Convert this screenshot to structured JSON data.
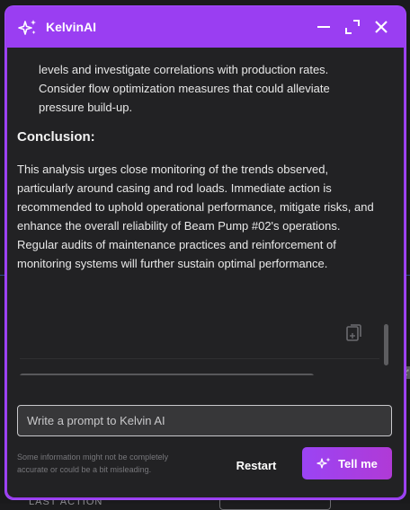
{
  "window": {
    "title": "KelvinAI"
  },
  "chat": {
    "continuation_text": "levels and investigate correlations with production rates. Consider flow optimization measures that could alleviate pressure build-up.",
    "conclusion_heading": "Conclusion:",
    "conclusion_text": "This analysis urges close monitoring of the trends observed, particularly around casing and rod loads. Immediate action is recommended to uphold operational performance, mitigate risks, and enhance the overall reliability of Beam Pump #02's operations. Regular audits of maintenance practices and reinforcement of monitoring systems will further sustain optimal performance."
  },
  "prompt": {
    "placeholder": "Write a prompt to Kelvin AI",
    "value": ""
  },
  "footer": {
    "disclaimer": "Some information might not be completely accurate or could be a bit misleading.",
    "restart_label": "Restart",
    "tell_me_label": "Tell me"
  },
  "background": {
    "bottom_label": "LAST ACTION",
    "right_tab_text": "2'"
  },
  "colors": {
    "accent": "#9b3ef0",
    "panel": "#222224",
    "input_bg": "#373739"
  },
  "icons": [
    "sparkle-icon",
    "minimize-icon",
    "maximize-icon",
    "close-icon",
    "copy-icon"
  ]
}
